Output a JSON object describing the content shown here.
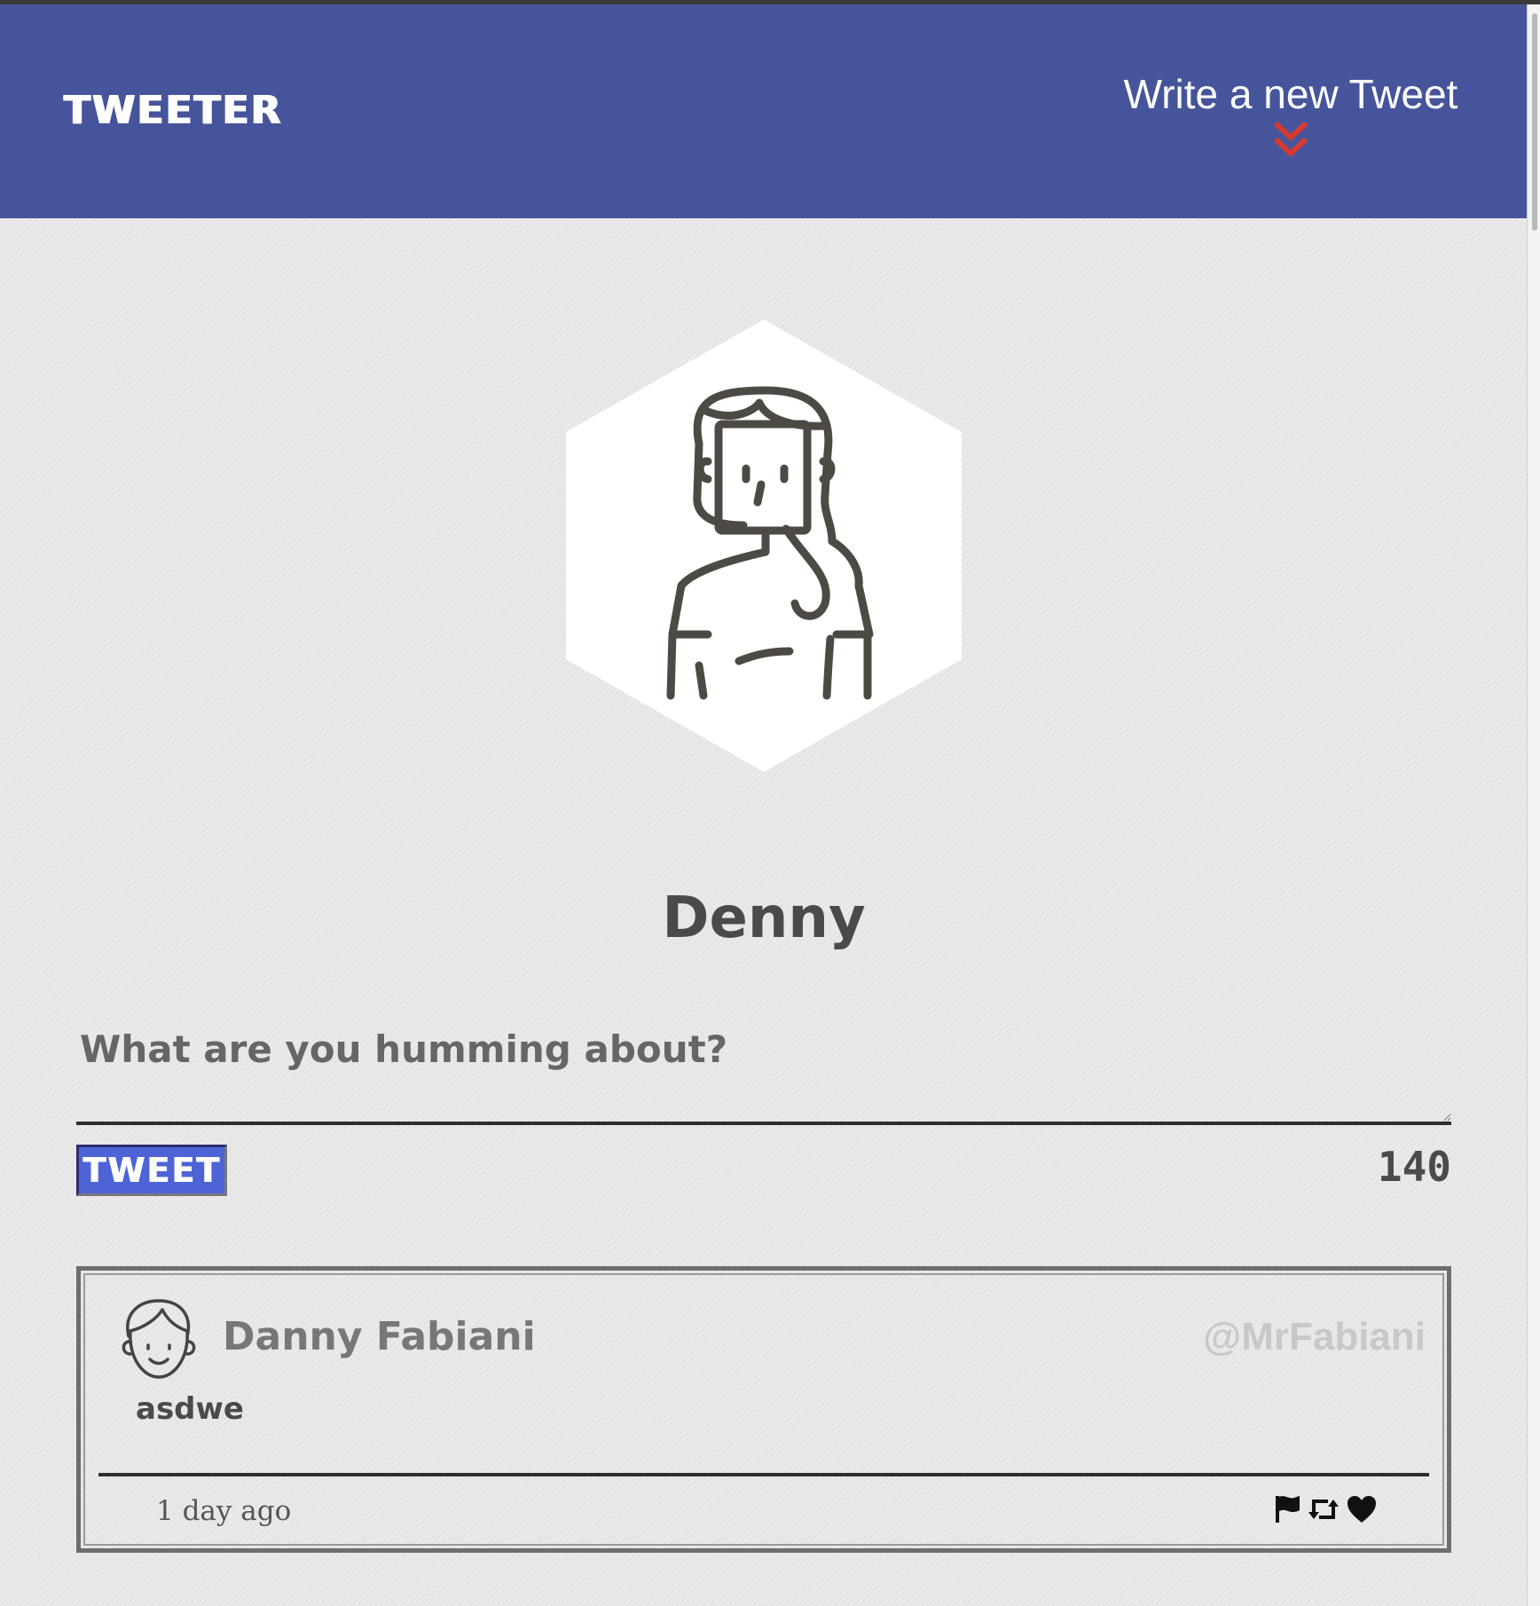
{
  "header": {
    "logo": "TWEETER",
    "compose_toggle_label": "Write a new Tweet",
    "chevron_color": "#d83a2b",
    "background_color": "#46549b"
  },
  "profile": {
    "name": "Denny",
    "avatar_icon": "woman-avatar-icon"
  },
  "compose": {
    "placeholder": "What are you humming about?",
    "button_label": "TWEET",
    "char_count": "140"
  },
  "tweets": [
    {
      "author": "Danny Fabiani",
      "handle": "@MrFabiani",
      "body": "asdwe",
      "time": "1 day ago",
      "avatar_icon": "man-avatar-icon",
      "actions": [
        "flag-icon",
        "retweet-icon",
        "heart-icon"
      ]
    }
  ]
}
